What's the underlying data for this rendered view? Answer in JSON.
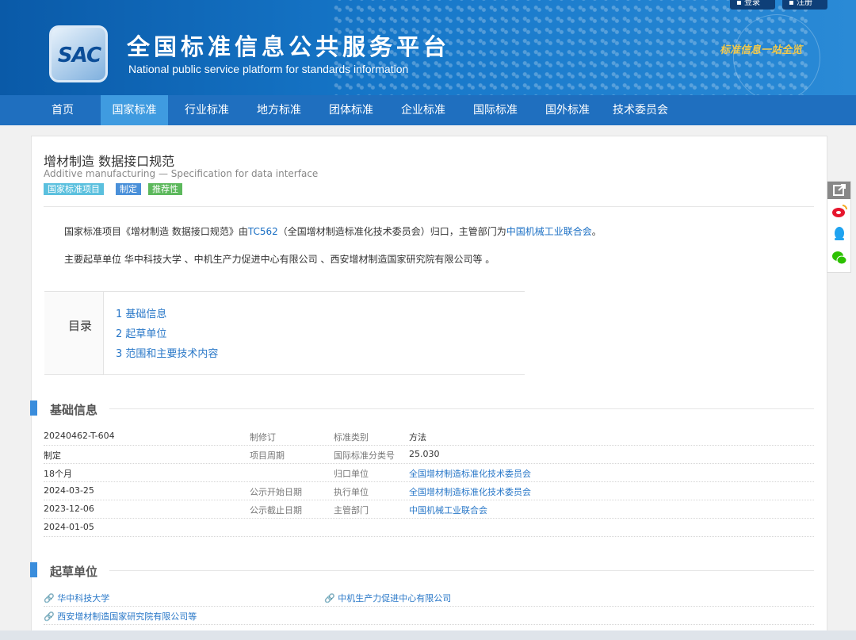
{
  "header": {
    "logo_text": "SAC",
    "title_cn": "全国标准信息公共服务平台",
    "title_en": "National public service platform  for standards information",
    "slogan": "标准信息一站全览",
    "login": "登录",
    "register": "注册"
  },
  "nav": [
    "首页",
    "国家标准",
    "行业标准",
    "地方标准",
    "团体标准",
    "企业标准",
    "国际标准",
    "国外标准",
    "技术委员会"
  ],
  "colors": {
    "accent": "#1f6fbf",
    "link": "#2a78c8",
    "tag_blue": "#5bc0de",
    "tag_green": "#5cb85c"
  },
  "standard": {
    "title": "增材制造 数据接口规范",
    "title_en": "Additive manufacturing — Specification for data interface",
    "tags": [
      "国家标准项目",
      "制定",
      "推荐性"
    ]
  },
  "intro": {
    "p1_a": "国家标准项目《增材制造 数据接口规范》由",
    "p1_tc": "TC562",
    "p1_b": "（全国增材制造标准化技术委员会）归口，主管部门为",
    "p1_dept": "中国机械工业联合会",
    "p1_c": "。",
    "p2": "主要起草单位 华中科技大学 、中机生产力促进中心有限公司 、西安增材制造国家研究院有限公司等 。"
  },
  "toc": {
    "label": "目录",
    "items": [
      "1  基础信息",
      "2  起草单位",
      "3  范围和主要技术内容"
    ]
  },
  "basic": {
    "title": "基础信息",
    "rows": [
      [
        "20240462-T-604",
        "制修订",
        "标准类别",
        "方法"
      ],
      [
        "制定",
        "项目周期",
        "国际标准分类号",
        "25.030"
      ],
      [
        "18个月",
        "",
        "归口单位",
        "全国增材制造标准化技术委员会"
      ],
      [
        "2024-03-25",
        "公示开始日期",
        "执行单位",
        "全国增材制造标准化技术委员会"
      ],
      [
        "2023-12-06",
        "公示截止日期",
        "主管部门",
        "中国机械工业联合会"
      ],
      [
        "2024-01-05",
        "",
        "",
        ""
      ]
    ]
  },
  "drafters": {
    "title": "起草单位",
    "items": [
      "华中科技大学",
      "中机生产力促进中心有限公司",
      "西安增材制造国家研究院有限公司等"
    ]
  },
  "share_icons": [
    "share-icon",
    "weibo-icon",
    "qq-icon",
    "wechat-icon"
  ]
}
